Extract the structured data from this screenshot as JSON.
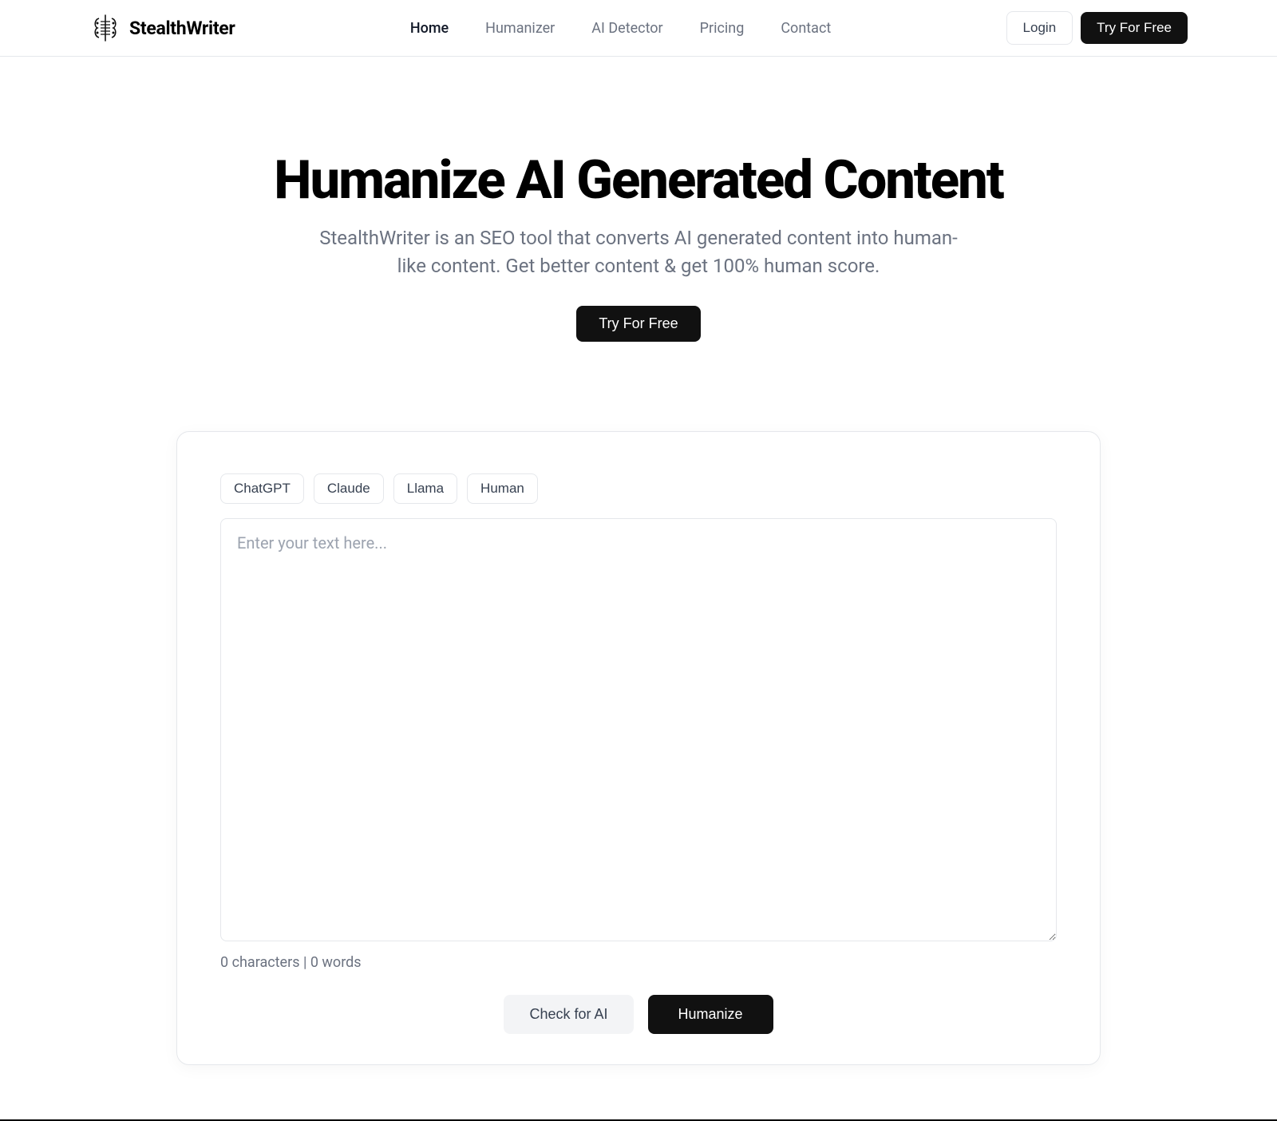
{
  "header": {
    "brand": "StealthWriter",
    "nav": [
      {
        "label": "Home",
        "active": true
      },
      {
        "label": "Humanizer",
        "active": false
      },
      {
        "label": "AI Detector",
        "active": false
      },
      {
        "label": "Pricing",
        "active": false
      },
      {
        "label": "Contact",
        "active": false
      }
    ],
    "login_label": "Login",
    "cta_label": "Try For Free"
  },
  "hero": {
    "title": "Humanize AI Generated Content",
    "subtitle": "StealthWriter is an SEO tool that converts AI generated content into human-like content. Get better content & get 100% human score.",
    "cta_label": "Try For Free"
  },
  "editor": {
    "chips": [
      "ChatGPT",
      "Claude",
      "Llama",
      "Human"
    ],
    "placeholder": "Enter your text here...",
    "value": "",
    "counter": "0 characters | 0 words",
    "check_label": "Check for AI",
    "humanize_label": "Humanize"
  }
}
